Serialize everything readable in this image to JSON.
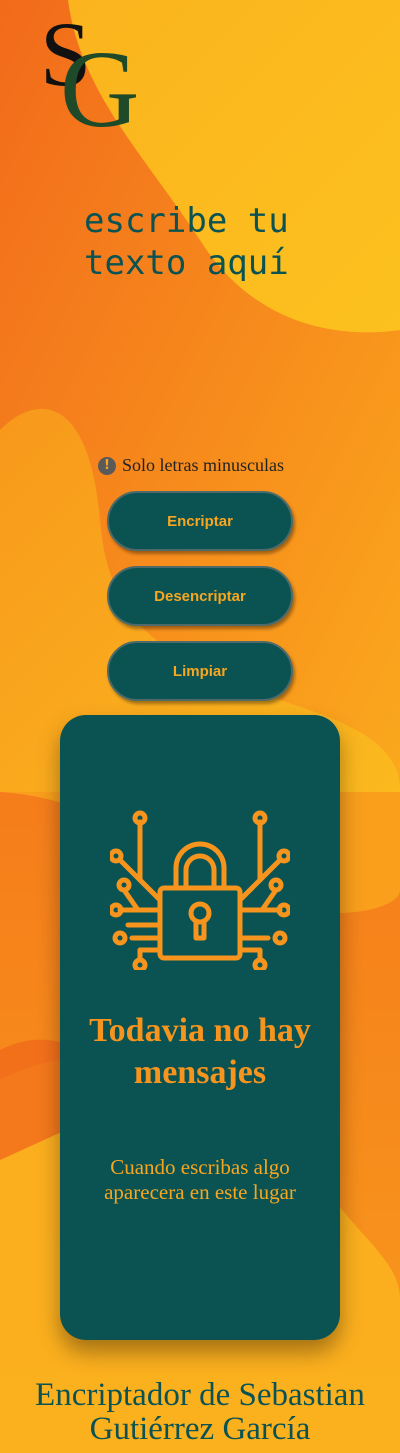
{
  "logo": {
    "letter1": "S",
    "letter2": "G"
  },
  "input": {
    "placeholder": "escribe tu texto aquí"
  },
  "hint": {
    "icon": "exclamation-icon",
    "text": "Solo letras minusculas"
  },
  "buttons": {
    "encrypt": "Encriptar",
    "decrypt": "Desencriptar",
    "clear": "Limpiar"
  },
  "output": {
    "icon": "circuit-lock-icon",
    "title": "Todavia no hay mensajes",
    "subtitle": "Cuando escribas algo aparecera en este lugar"
  },
  "footer": {
    "text": "Encriptador de Sebastian Gutiérrez García"
  },
  "colors": {
    "teal": "#0b5352",
    "orange": "#f7941d",
    "amber": "#f7a620"
  }
}
